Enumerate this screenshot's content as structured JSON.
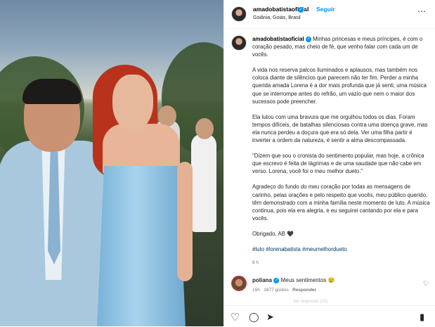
{
  "header": {
    "username": "amadobatistaoficial",
    "separator": "•",
    "follow_label": "Seguir",
    "location": "Goiânia, Goiás, Brasil",
    "more_icon": "⋯"
  },
  "caption": {
    "username": "amadobatistaoficial",
    "p1": "Minhas princesas e meus príncipes, é com o coração pesado, mas cheio de fé, que venho falar com cada um de vocês.",
    "p2": "A vida nos reserva palcos iluminados e aplausos, mas também nos coloca diante de silêncios que parecem não ter fim. Perder a minha querida amada Lorena é a dor mais profunda que já senti, uma música que se interrompe antes do refrão, um vazio que nem o maior dos sucessos pode preencher.",
    "p3": "Ela lutou com uma bravura que me orgulhou todos os dias. Foram tempos difíceis, de batalhas silenciosas contra uma doença grave, mas ela nunca perdeu a doçura que era só dela. Ver uma filha partir é inverter a ordem da natureza, é sentir a alma descompassada.",
    "p4": "\"Dizem que sou o cronista do sentimento popular, mas hoje, a crônica que escrevo é feita de lágrimas e de uma saudade que não cabe em verso. Lorena, você foi o meu melhor dueto.\"",
    "p5": "Agradeço do fundo do meu coração por todas as mensagens de carinho, pelas orações e pelo respeito que vocês, meu público querido, têm demonstrado com a minha família neste momento de luto. A música continua, pois ela era alegria, e eu seguirei cantando por ela e para vocês.",
    "p6": "Obrigado, AB 🖤",
    "hashtags": "#luto #lorenabatista #meumelhordueto",
    "time": "8 h"
  },
  "comment": {
    "username": "poliana",
    "text": "Meus sentimentos 😢",
    "age": "15h",
    "likes": "1877 gostos",
    "reply": "Responder",
    "partial_below": "Ver respostas (10)"
  },
  "icons": {
    "like": "♡",
    "comment": "◯",
    "share": "➤",
    "save": "▮",
    "verified": "✓"
  }
}
